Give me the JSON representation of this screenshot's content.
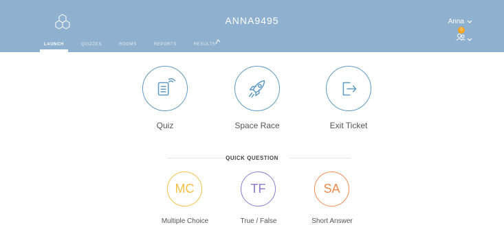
{
  "header": {
    "room_name": "ANNA9495",
    "user_name": "Anna",
    "notification_count": "0",
    "background_color": "#8fb1cf",
    "logo_icon": "hexagon-logo-icon"
  },
  "nav": {
    "tabs": [
      {
        "label": "LAUNCH",
        "active": true
      },
      {
        "label": "QUIZZES",
        "active": false
      },
      {
        "label": "ROOMS",
        "active": false
      },
      {
        "label": "REPORTS",
        "active": false
      },
      {
        "label": "RESULTS",
        "active": false
      }
    ]
  },
  "launch": {
    "items": [
      {
        "label": "Quiz",
        "icon": "quiz-document-icon"
      },
      {
        "label": "Space Race",
        "icon": "rocket-icon"
      },
      {
        "label": "Exit Ticket",
        "icon": "exit-door-icon"
      }
    ],
    "accent_color": "#5f9ac3"
  },
  "quick_question": {
    "title": "QUICK QUESTION",
    "items": [
      {
        "abbr": "MC",
        "label": "Multiple Choice",
        "color": "#f4c043"
      },
      {
        "abbr": "TF",
        "label": "True / False",
        "color": "#8b79cf"
      },
      {
        "abbr": "SA",
        "label": "Short Answer",
        "color": "#f08a50"
      }
    ]
  }
}
